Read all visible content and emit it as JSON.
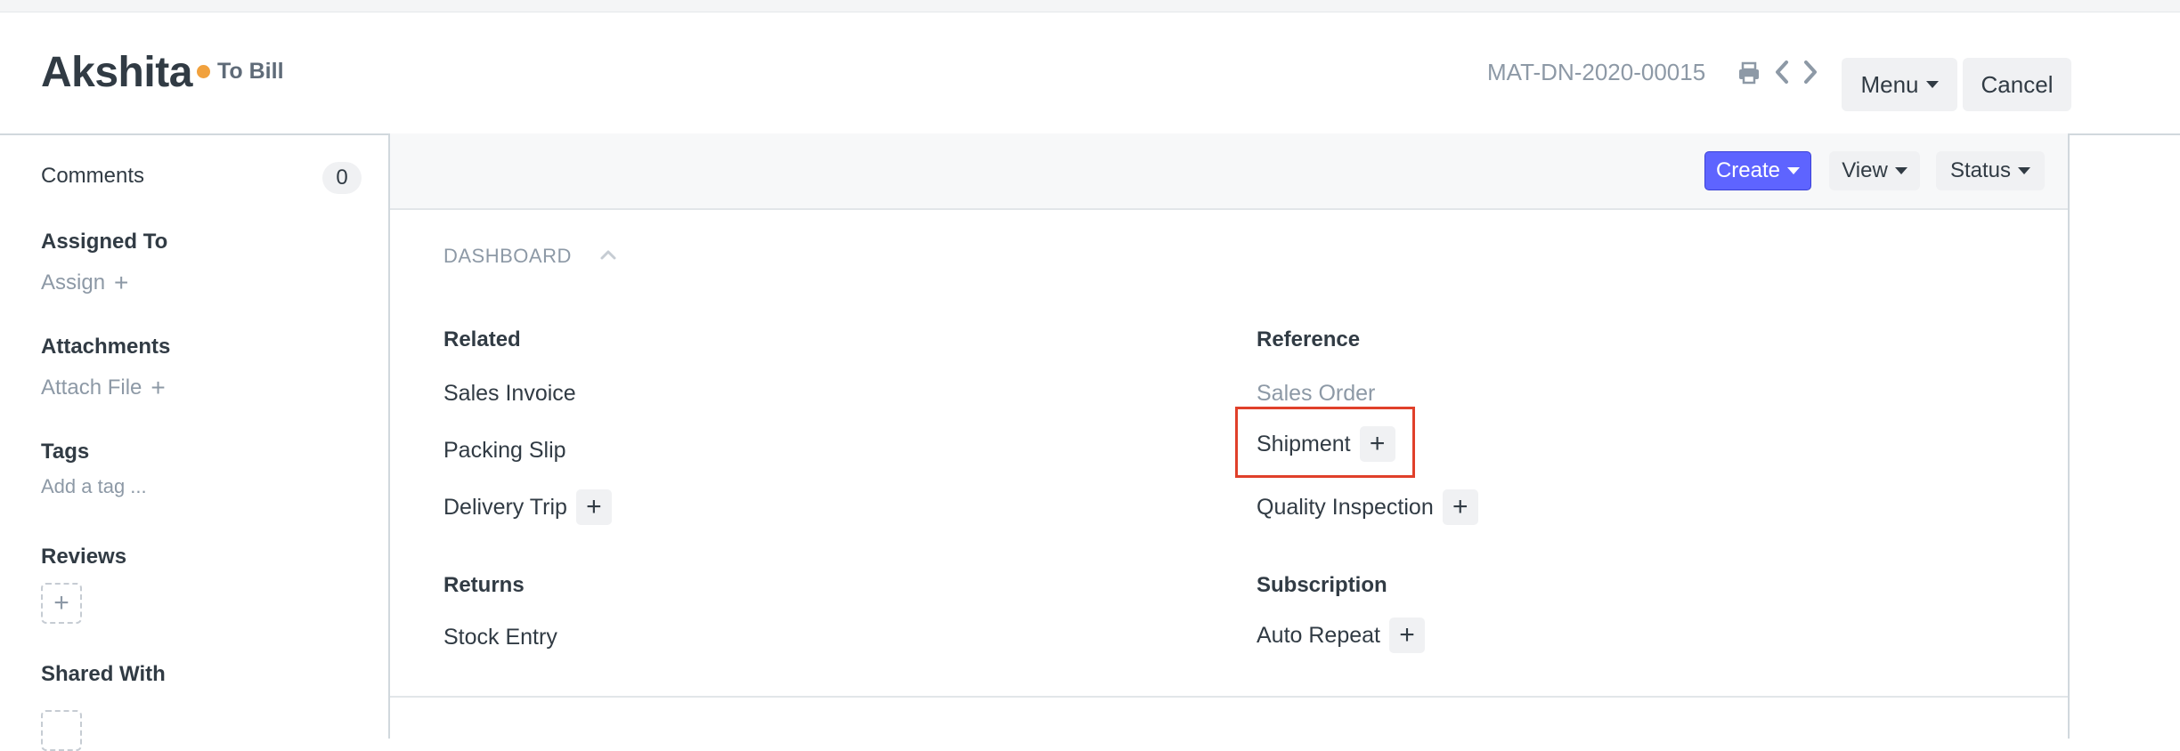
{
  "header": {
    "title": "Akshita",
    "status": "To Bill",
    "status_color": "#f1a13d",
    "doc_name": "MAT-DN-2020-00015",
    "menu_label": "Menu",
    "cancel_label": "Cancel"
  },
  "sidebar": {
    "comments_label": "Comments",
    "comments_count": "0",
    "assigned_to_label": "Assigned To",
    "assign_label": "Assign",
    "attachments_label": "Attachments",
    "attach_file_label": "Attach File",
    "tags_label": "Tags",
    "add_tag_label": "Add a tag ...",
    "reviews_label": "Reviews",
    "shared_with_label": "Shared With"
  },
  "toolbar": {
    "create_label": "Create",
    "view_label": "View",
    "status_label": "Status",
    "accent_color": "#5e64ff"
  },
  "dashboard": {
    "title": "DASHBOARD",
    "groups": {
      "related": {
        "label": "Related",
        "items": [
          "Sales Invoice",
          "Packing Slip",
          "Delivery Trip"
        ]
      },
      "reference": {
        "label": "Reference",
        "items": [
          "Sales Order",
          "Shipment",
          "Quality Inspection"
        ]
      },
      "returns": {
        "label": "Returns",
        "items": [
          "Stock Entry"
        ]
      },
      "subscription": {
        "label": "Subscription",
        "items": [
          "Auto Repeat"
        ]
      }
    },
    "plus_symbol": "+"
  }
}
